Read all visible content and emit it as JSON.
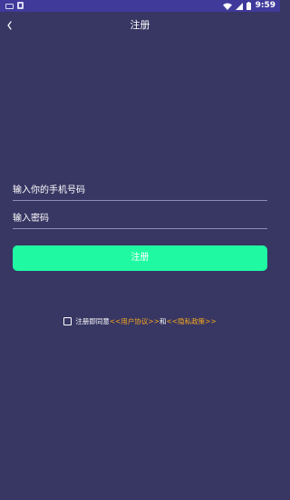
{
  "status_bar": {
    "time": "9:59"
  },
  "header": {
    "title": "注册"
  },
  "form": {
    "phone_placeholder": "输入你的手机号码",
    "password_placeholder": "输入密码",
    "register_label": "注册"
  },
  "agreement": {
    "prefix": "注册即同意",
    "user_agreement_link": "<<用户协议>>",
    "conjunction": "和",
    "privacy_policy_link": "<<隐私政策>>",
    "checked": false
  },
  "colors": {
    "background": "#383663",
    "status_bar": "#403a9b",
    "button": "#1ffaa2",
    "link": "#f5a91e"
  }
}
